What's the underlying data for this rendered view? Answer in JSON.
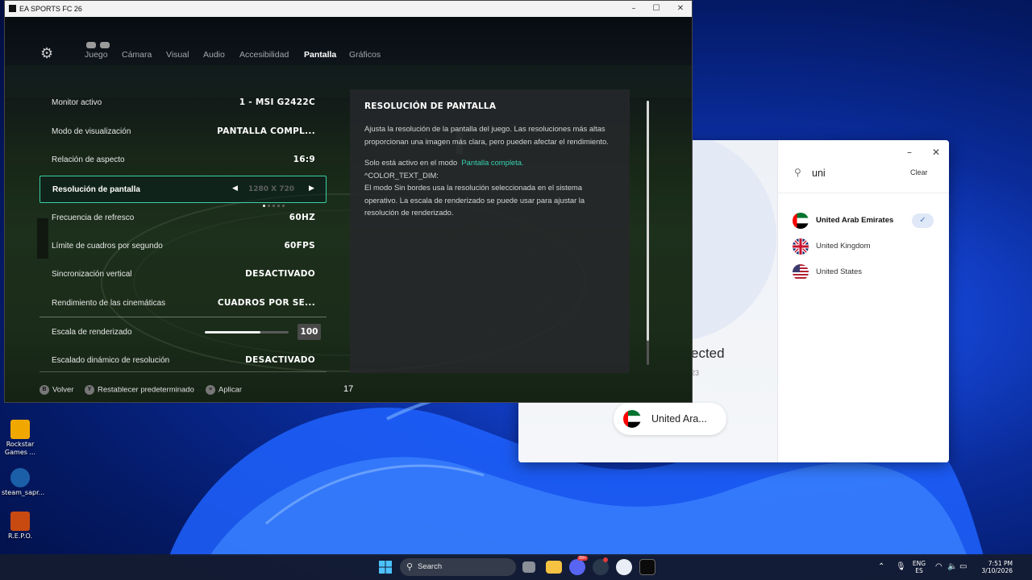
{
  "window": {
    "title": "EA SPORTS FC 26"
  },
  "tabs": [
    "Juego",
    "Cámara",
    "Visual",
    "Audio",
    "Accesibilidad",
    "Pantalla",
    "Gráficos"
  ],
  "active_tab": "Pantalla",
  "settings": [
    {
      "label": "Monitor activo",
      "value": "1 - MSI G2422C"
    },
    {
      "label": "Modo de visualización",
      "value": "PANTALLA COMPL..."
    },
    {
      "label": "Relación de aspecto",
      "value": "16:9"
    },
    {
      "label": "Resolución de pantalla",
      "value": "1280 X 720",
      "selected": true
    },
    {
      "label": "Frecuencia de refresco",
      "value": "60HZ"
    },
    {
      "label": "Límite de cuadros por segundo",
      "value": "60FPS"
    },
    {
      "label": "Sincronización vertical",
      "value": "DESACTIVADO"
    },
    {
      "label": "Rendimiento de las cinemáticas",
      "value": "CUADROS POR SE..."
    },
    {
      "label": "Escala de renderizado",
      "value": "100",
      "slider_fraction": 0.66
    },
    {
      "label": "Escalado dinámico de resolución",
      "value": "DESACTIVADO"
    }
  ],
  "info": {
    "title": "RESOLUCIÓN DE PANTALLA",
    "desc": "Ajusta la resolución de la pantalla del juego. Las resoluciones más altas proporcionan una imagen más clara, pero pueden afectar el rendimiento.",
    "note_prefix": "Solo está activo en el modo",
    "note_highlight": "Pantalla completa.",
    "note_code": "^COLOR_TEXT_DIM:",
    "note_rest": "El modo Sin bordes usa la resolución seleccionada en el sistema operativo. La escala de renderizado se puede usar para ajustar la resolución de renderizado."
  },
  "footer": {
    "back": "Volver",
    "back_key": "B",
    "reset": "Restablecer predeterminado",
    "reset_key": "Y",
    "apply": "Aplicar",
    "apply_key": "≡",
    "counter": "17"
  },
  "vpn": {
    "search_value": "uni",
    "clear": "Clear",
    "countries": [
      "United Arab Emirates",
      "United Kingdom",
      "United States"
    ],
    "selected_country": "United Arab Emirates",
    "status_partial": "ected",
    "sub_partial": "23",
    "pill_label": "United Ara..."
  },
  "desktop_icons": [
    {
      "label": "Rockstar Games ...",
      "color": "#f0a800"
    },
    {
      "label": "steam_sapr...",
      "color": "#1b5fa8"
    },
    {
      "label": "R.E.P.O.",
      "color": "#c84a10"
    }
  ],
  "taskbar": {
    "search_label": "Search",
    "lang_top": "ENG",
    "lang_bottom": "ES",
    "time": "7:51 PM",
    "date": "3/10/2026",
    "discord_badge": "99+"
  },
  "colors": {
    "accent": "#3ccfa8",
    "highlight": "#35d4b0"
  }
}
